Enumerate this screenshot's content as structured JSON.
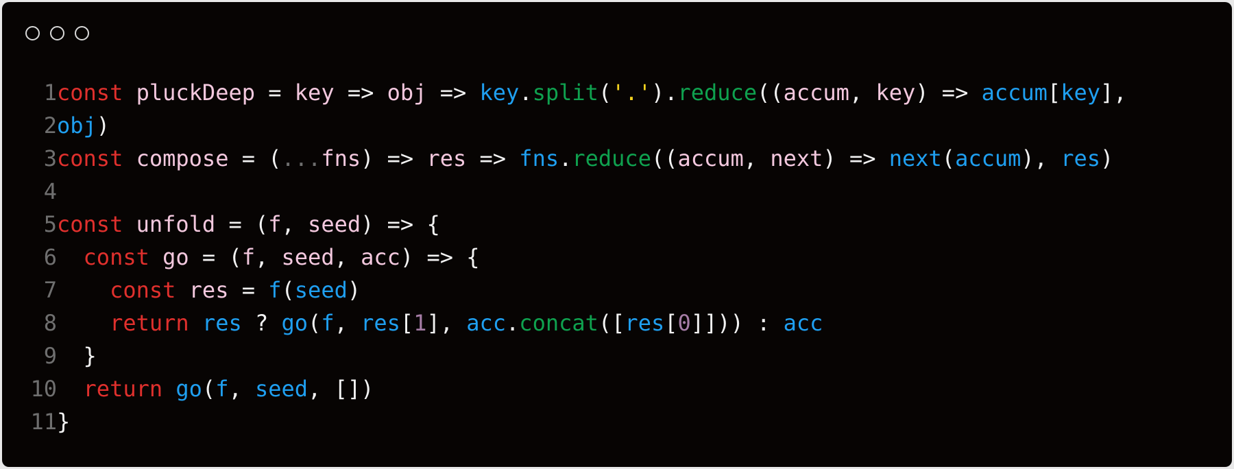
{
  "window": {
    "controls": [
      "window-dot",
      "window-dot",
      "window-dot"
    ]
  },
  "code": {
    "language": "javascript",
    "lines": [
      {
        "n": "1",
        "tokens": [
          {
            "t": "const",
            "c": "kw"
          },
          {
            "t": " ",
            "c": "wt"
          },
          {
            "t": "pluckDeep",
            "c": "id"
          },
          {
            "t": " = ",
            "c": "wt"
          },
          {
            "t": "key",
            "c": "id"
          },
          {
            "t": " => ",
            "c": "wt"
          },
          {
            "t": "obj",
            "c": "id"
          },
          {
            "t": " => ",
            "c": "wt"
          },
          {
            "t": "key",
            "c": "bl"
          },
          {
            "t": ".",
            "c": "wt"
          },
          {
            "t": "split",
            "c": "gn"
          },
          {
            "t": "(",
            "c": "wt"
          },
          {
            "t": "'.'",
            "c": "st"
          },
          {
            "t": ").",
            "c": "wt"
          },
          {
            "t": "reduce",
            "c": "gn"
          },
          {
            "t": "((",
            "c": "wt"
          },
          {
            "t": "accum",
            "c": "id"
          },
          {
            "t": ", ",
            "c": "wt"
          },
          {
            "t": "key",
            "c": "id"
          },
          {
            "t": ") => ",
            "c": "wt"
          },
          {
            "t": "accum",
            "c": "bl"
          },
          {
            "t": "[",
            "c": "wt"
          },
          {
            "t": "key",
            "c": "bl"
          },
          {
            "t": "],",
            "c": "wt"
          }
        ]
      },
      {
        "n": "2",
        "tokens": [
          {
            "t": "obj",
            "c": "bl"
          },
          {
            "t": ")",
            "c": "wt"
          }
        ]
      },
      {
        "n": "3",
        "tokens": [
          {
            "t": "const",
            "c": "kw"
          },
          {
            "t": " ",
            "c": "wt"
          },
          {
            "t": "compose",
            "c": "id"
          },
          {
            "t": " = (",
            "c": "wt"
          },
          {
            "t": "...",
            "c": "dm"
          },
          {
            "t": "fns",
            "c": "id"
          },
          {
            "t": ") => ",
            "c": "wt"
          },
          {
            "t": "res",
            "c": "id"
          },
          {
            "t": " => ",
            "c": "wt"
          },
          {
            "t": "fns",
            "c": "bl"
          },
          {
            "t": ".",
            "c": "wt"
          },
          {
            "t": "reduce",
            "c": "gn"
          },
          {
            "t": "((",
            "c": "wt"
          },
          {
            "t": "accum",
            "c": "id"
          },
          {
            "t": ", ",
            "c": "wt"
          },
          {
            "t": "next",
            "c": "id"
          },
          {
            "t": ") => ",
            "c": "wt"
          },
          {
            "t": "next",
            "c": "bl"
          },
          {
            "t": "(",
            "c": "wt"
          },
          {
            "t": "accum",
            "c": "bl"
          },
          {
            "t": "), ",
            "c": "wt"
          },
          {
            "t": "res",
            "c": "bl"
          },
          {
            "t": ")",
            "c": "wt"
          }
        ]
      },
      {
        "n": "4",
        "tokens": []
      },
      {
        "n": "5",
        "tokens": [
          {
            "t": "const",
            "c": "kw"
          },
          {
            "t": " ",
            "c": "wt"
          },
          {
            "t": "unfold",
            "c": "id"
          },
          {
            "t": " = (",
            "c": "wt"
          },
          {
            "t": "f",
            "c": "id"
          },
          {
            "t": ", ",
            "c": "wt"
          },
          {
            "t": "seed",
            "c": "id"
          },
          {
            "t": ") => {",
            "c": "wt"
          }
        ]
      },
      {
        "n": "6",
        "tokens": [
          {
            "t": "  ",
            "c": "wt"
          },
          {
            "t": "const",
            "c": "kw"
          },
          {
            "t": " ",
            "c": "wt"
          },
          {
            "t": "go",
            "c": "id"
          },
          {
            "t": " = (",
            "c": "wt"
          },
          {
            "t": "f",
            "c": "id"
          },
          {
            "t": ", ",
            "c": "wt"
          },
          {
            "t": "seed",
            "c": "id"
          },
          {
            "t": ", ",
            "c": "wt"
          },
          {
            "t": "acc",
            "c": "id"
          },
          {
            "t": ") => {",
            "c": "wt"
          }
        ]
      },
      {
        "n": "7",
        "tokens": [
          {
            "t": "    ",
            "c": "wt"
          },
          {
            "t": "const",
            "c": "kw"
          },
          {
            "t": " ",
            "c": "wt"
          },
          {
            "t": "res",
            "c": "id"
          },
          {
            "t": " = ",
            "c": "wt"
          },
          {
            "t": "f",
            "c": "bl"
          },
          {
            "t": "(",
            "c": "wt"
          },
          {
            "t": "seed",
            "c": "bl"
          },
          {
            "t": ")",
            "c": "wt"
          }
        ]
      },
      {
        "n": "8",
        "tokens": [
          {
            "t": "    ",
            "c": "wt"
          },
          {
            "t": "return",
            "c": "kw"
          },
          {
            "t": " ",
            "c": "wt"
          },
          {
            "t": "res",
            "c": "bl"
          },
          {
            "t": " ? ",
            "c": "wt"
          },
          {
            "t": "go",
            "c": "bl"
          },
          {
            "t": "(",
            "c": "wt"
          },
          {
            "t": "f",
            "c": "bl"
          },
          {
            "t": ", ",
            "c": "wt"
          },
          {
            "t": "res",
            "c": "bl"
          },
          {
            "t": "[",
            "c": "wt"
          },
          {
            "t": "1",
            "c": "nm"
          },
          {
            "t": "], ",
            "c": "wt"
          },
          {
            "t": "acc",
            "c": "bl"
          },
          {
            "t": ".",
            "c": "wt"
          },
          {
            "t": "concat",
            "c": "gn"
          },
          {
            "t": "([",
            "c": "wt"
          },
          {
            "t": "res",
            "c": "bl"
          },
          {
            "t": "[",
            "c": "wt"
          },
          {
            "t": "0",
            "c": "nm"
          },
          {
            "t": "]])) : ",
            "c": "wt"
          },
          {
            "t": "acc",
            "c": "bl"
          }
        ]
      },
      {
        "n": "9",
        "tokens": [
          {
            "t": "  }",
            "c": "wt"
          }
        ]
      },
      {
        "n": "10",
        "tokens": [
          {
            "t": "  ",
            "c": "wt"
          },
          {
            "t": "return",
            "c": "kw"
          },
          {
            "t": " ",
            "c": "wt"
          },
          {
            "t": "go",
            "c": "bl"
          },
          {
            "t": "(",
            "c": "wt"
          },
          {
            "t": "f",
            "c": "bl"
          },
          {
            "t": ", ",
            "c": "wt"
          },
          {
            "t": "seed",
            "c": "bl"
          },
          {
            "t": ", [])",
            "c": "wt"
          }
        ]
      },
      {
        "n": "11",
        "tokens": [
          {
            "t": "}",
            "c": "wt"
          }
        ]
      }
    ]
  },
  "colors": {
    "background": "#070403",
    "keyword": "#e0302d",
    "identifier": "#f3c8de",
    "plain": "#f2f2f2",
    "reference": "#1f9ff0",
    "method": "#0fa14f",
    "string": "#f4d21f",
    "line_number": "#6f6f6f",
    "number": "#a67da6"
  }
}
